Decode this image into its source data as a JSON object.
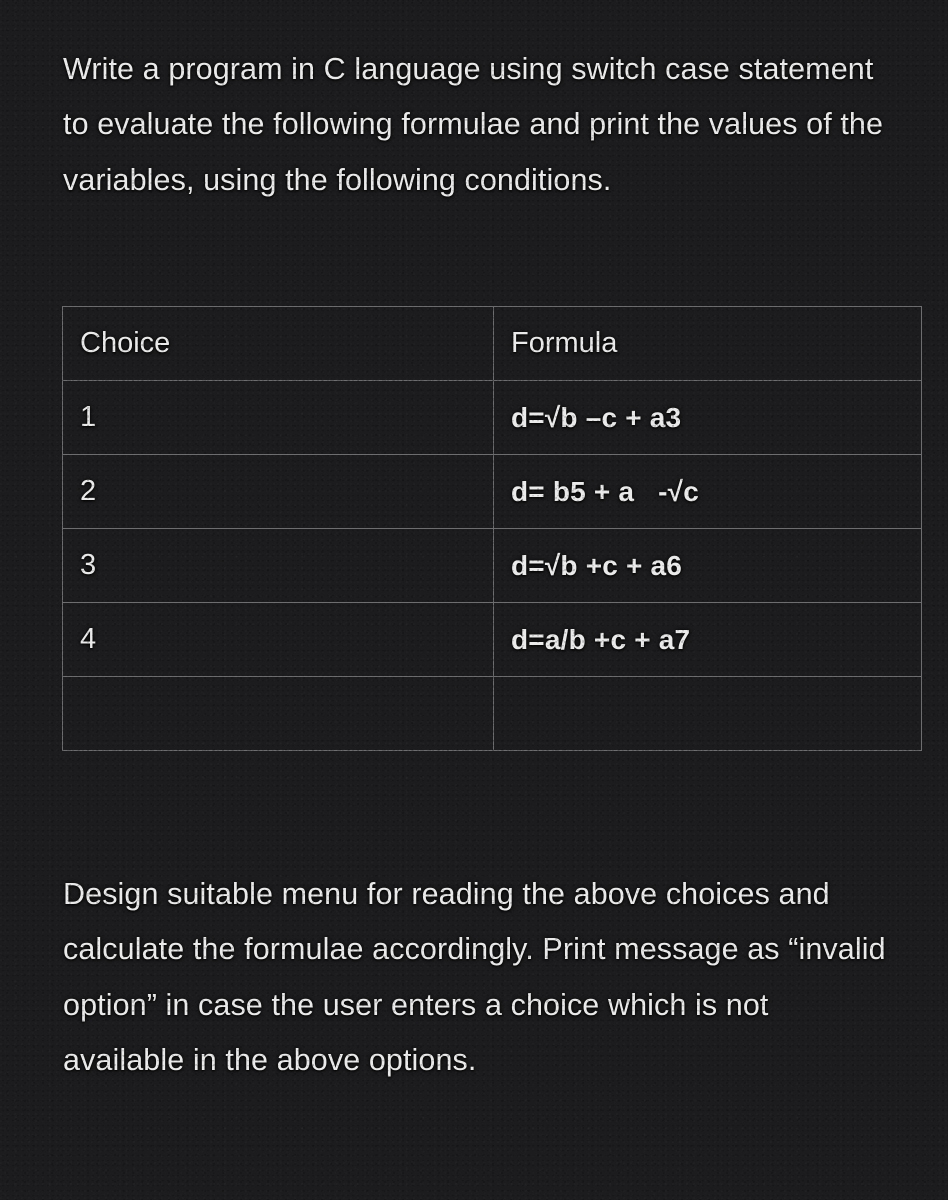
{
  "intro_paragraph": "Write a program in C language using switch case statement to evaluate the following formulae and print the values of the variables, using the following conditions.",
  "table": {
    "headers": {
      "choice": "Choice",
      "formula": "Formula"
    },
    "rows": [
      {
        "choice": "1",
        "formula": "d=√b –c + a3"
      },
      {
        "choice": "2",
        "formula": "d= b5 + a   -√c"
      },
      {
        "choice": "3",
        "formula": "d=√b +c + a6"
      },
      {
        "choice": "4",
        "formula": "d=a/b +c + a7"
      },
      {
        "choice": "",
        "formula": ""
      }
    ]
  },
  "closing_paragraph": "Design suitable menu for reading the above choices and calculate the formulae accordingly. Print message as “invalid option” in case the user enters a choice which is not available in the above options.",
  "colors": {
    "background": "#1c1c1e",
    "text": "#eaeaea",
    "table_border": "#6d6d70"
  }
}
